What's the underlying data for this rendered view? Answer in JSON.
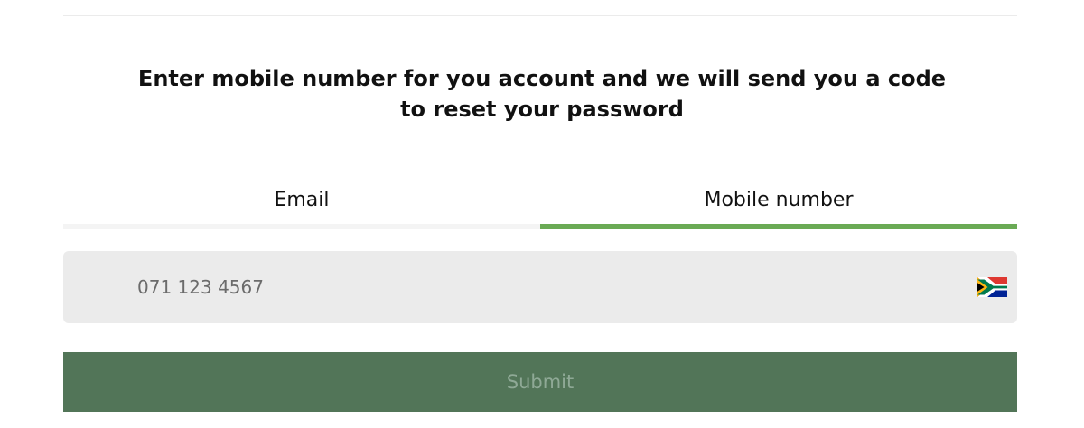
{
  "instruction": "Enter mobile number for you account and we will send you a code to reset your password",
  "tabs": [
    {
      "label": "Email",
      "active": false
    },
    {
      "label": "Mobile number",
      "active": true
    }
  ],
  "phone": {
    "placeholder": "071 123 4567",
    "value": "",
    "country_flag_icon": "south-africa-flag-icon"
  },
  "submit_label": "Submit",
  "colors": {
    "active_tab_underline": "#6aaa55",
    "inactive_tab_underline": "#f4f4f4",
    "field_background": "#ebebeb",
    "submit_background": "#527558",
    "submit_text": "#8fa996"
  }
}
